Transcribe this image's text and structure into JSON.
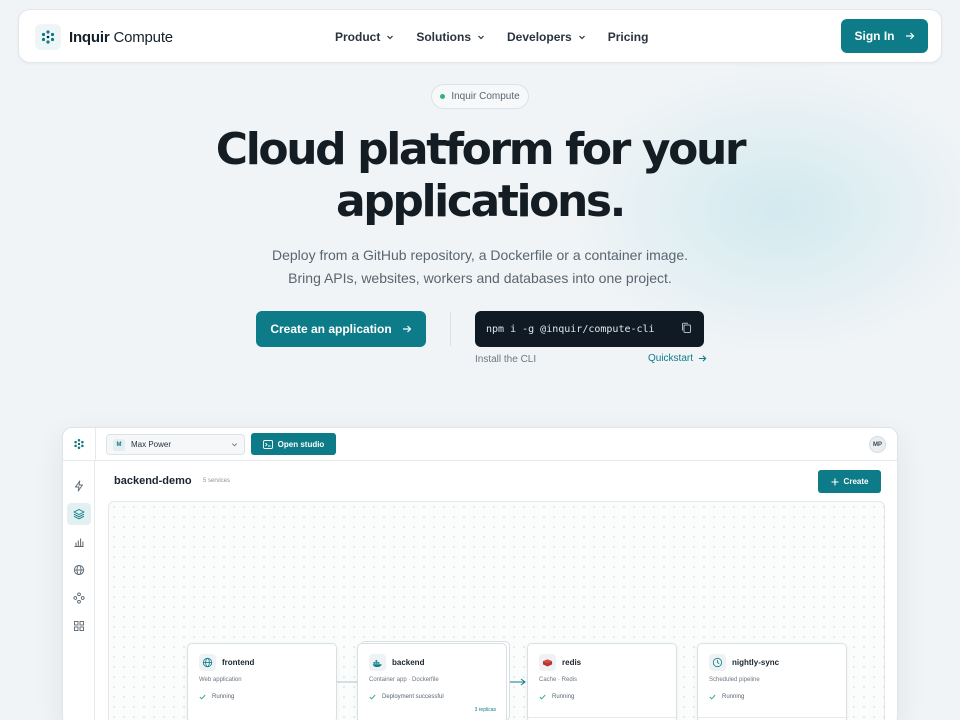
{
  "brand": {
    "name": "Inquir",
    "suffix": "Compute"
  },
  "nav": {
    "items": [
      {
        "label": "Product",
        "has_dropdown": true
      },
      {
        "label": "Solutions",
        "has_dropdown": true
      },
      {
        "label": "Developers",
        "has_dropdown": true
      },
      {
        "label": "Pricing",
        "has_dropdown": false
      }
    ],
    "signin_label": "Sign In"
  },
  "hero": {
    "badge": "Inquir Compute",
    "title_line1": "Cloud platform for your",
    "title_line2": "applications.",
    "subtitle_line1": "Deploy from a GitHub repository, a Dockerfile or a container image.",
    "subtitle_line2": "Bring APIs, websites, workers and databases into one project.",
    "cta_label": "Create an application",
    "cli_command": "npm i -g @inquir/compute-cli",
    "cli_caption": "Install the CLI",
    "quickstart_label": "Quickstart"
  },
  "app": {
    "workspace": {
      "badge": "M",
      "name": "Max Power"
    },
    "open_studio_label": "Open studio",
    "avatar_initials": "MP",
    "sidebar_icons": [
      "lightning-icon",
      "layers-icon",
      "bar-chart-icon",
      "globe-icon",
      "nodes-icon",
      "grid-icon"
    ],
    "sidebar_active_index": 1,
    "project": {
      "title": "backend-demo",
      "services_count": "5 services"
    },
    "create_label": "Create",
    "services": [
      {
        "name": "frontend",
        "subtitle": "Web application",
        "status": "Running",
        "icon": "globe-icon"
      },
      {
        "name": "backend",
        "subtitle": "Container app · Dockerfile",
        "status": "Deployment successful",
        "replicas": "3 replicas",
        "icon": "docker-icon"
      },
      {
        "name": "redis",
        "subtitle": "Cache · Redis",
        "status": "Running",
        "icon": "redis-icon"
      },
      {
        "name": "nightly-sync",
        "subtitle": "Scheduled pipeline",
        "status": "Running",
        "icon": "clock-icon"
      }
    ]
  },
  "colors": {
    "accent": "#0d7c88",
    "dark": "#0f1a24",
    "status_ok": "#34b27b",
    "redis": "#d8443a"
  }
}
